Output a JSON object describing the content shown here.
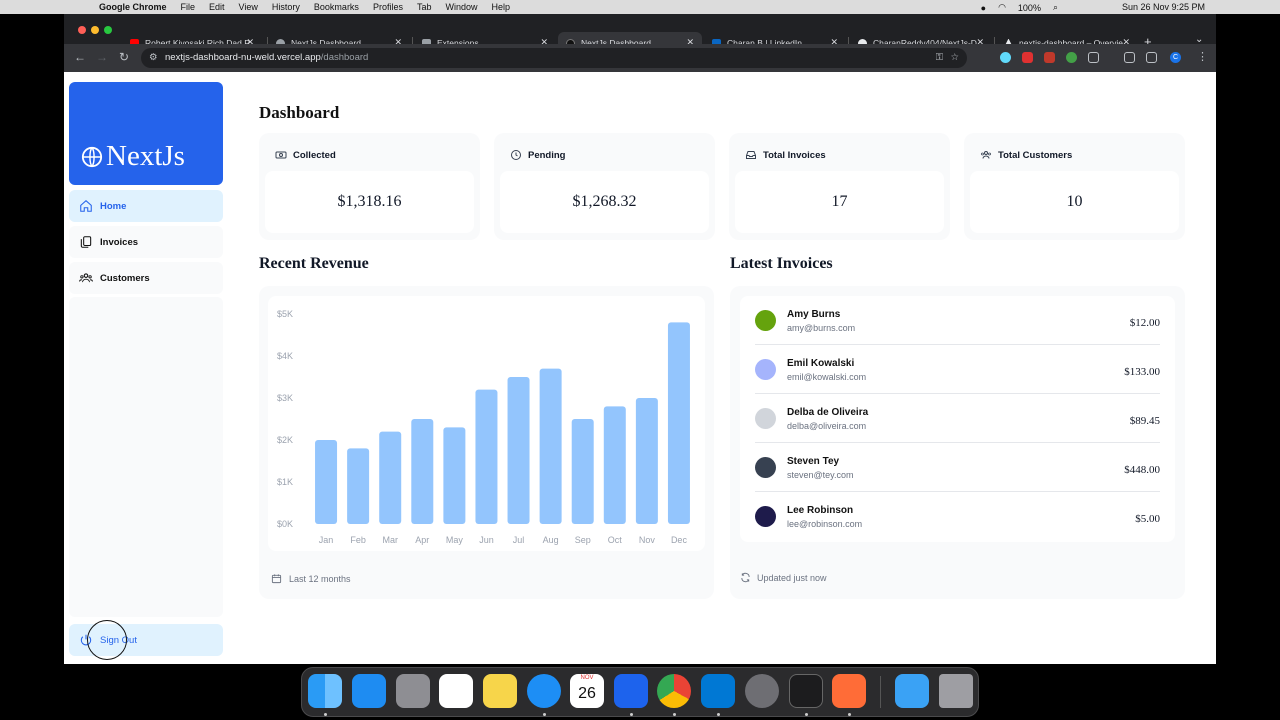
{
  "menubar": {
    "app": "Google Chrome",
    "menus": [
      "File",
      "Edit",
      "View",
      "History",
      "Bookmarks",
      "Profiles",
      "Tab",
      "Window",
      "Help"
    ],
    "battery": "100%",
    "clock": "Sun 26 Nov  9:25 PM"
  },
  "tabs": [
    {
      "title": "Robert Kiyosaki Rich Dad P",
      "favicon_color": "#ff0000"
    },
    {
      "title": "NextJs Dashboard",
      "favicon_color": "#9aa0a6"
    },
    {
      "title": "Extensions",
      "favicon_color": "#9aa0a6"
    },
    {
      "title": "NextJs Dashboard",
      "favicon_color": "#111111"
    },
    {
      "title": "Charan B | LinkedIn",
      "favicon_color": "#0a66c2"
    },
    {
      "title": "CharanReddy404/NextJs-D",
      "favicon_color": "#e8eaed"
    },
    {
      "title": "nextjs-dashboard – Overvie",
      "favicon_color": "#e8eaed"
    }
  ],
  "address": {
    "host": "nextjs-dashboard-nu-weld.vercel.app",
    "path": "/dashboard"
  },
  "profile_initial": "C",
  "sidebar": {
    "logo": "NextJs",
    "items": [
      {
        "label": "Home"
      },
      {
        "label": "Invoices"
      },
      {
        "label": "Customers"
      }
    ],
    "signout": "Sign Out"
  },
  "page": {
    "title": "Dashboard"
  },
  "cards": [
    {
      "label": "Collected",
      "value": "$1,318.16",
      "icon": "banknotes-icon"
    },
    {
      "label": "Pending",
      "value": "$1,268.32",
      "icon": "clock-icon"
    },
    {
      "label": "Total Invoices",
      "value": "17",
      "icon": "inbox-icon"
    },
    {
      "label": "Total Customers",
      "value": "10",
      "icon": "user-group-icon"
    }
  ],
  "revenue": {
    "title": "Recent Revenue",
    "footer": "Last 12 months"
  },
  "chart_data": {
    "type": "bar",
    "categories": [
      "Jan",
      "Feb",
      "Mar",
      "Apr",
      "May",
      "Jun",
      "Jul",
      "Aug",
      "Sep",
      "Oct",
      "Nov",
      "Dec"
    ],
    "values": [
      2000,
      1800,
      2200,
      2500,
      2300,
      3200,
      3500,
      3700,
      2500,
      2800,
      3000,
      4800
    ],
    "yticks": [
      "$0K",
      "$1K",
      "$2K",
      "$3K",
      "$4K",
      "$5K"
    ],
    "ylim": [
      0,
      5000
    ],
    "bar_color": "#93c5fd"
  },
  "invoices": {
    "title": "Latest Invoices",
    "footer": "Updated just now",
    "rows": [
      {
        "name": "Amy Burns",
        "email": "amy@burns.com",
        "amount": "$12.00",
        "avatar_color": "#65a30d"
      },
      {
        "name": "Emil Kowalski",
        "email": "emil@kowalski.com",
        "amount": "$133.00",
        "avatar_color": "#a5b4fc"
      },
      {
        "name": "Delba de Oliveira",
        "email": "delba@oliveira.com",
        "amount": "$89.45",
        "avatar_color": "#d1d5db"
      },
      {
        "name": "Steven Tey",
        "email": "steven@tey.com",
        "amount": "$448.00",
        "avatar_color": "#374151"
      },
      {
        "name": "Lee Robinson",
        "email": "lee@robinson.com",
        "amount": "$5.00",
        "avatar_color": "#1e1b4b"
      }
    ]
  },
  "dock": {
    "calendar_month": "NOV",
    "calendar_day": "26",
    "apps": [
      "finder-icon",
      "app-store-icon",
      "launchpad-icon",
      "slack-icon",
      "notes-icon",
      "safari-icon",
      "calendar-icon",
      "docker-icon",
      "chrome-icon",
      "vscode-icon",
      "system-settings-icon",
      "terminal-icon",
      "postman-icon",
      "folder-icon",
      "trash-icon"
    ]
  }
}
